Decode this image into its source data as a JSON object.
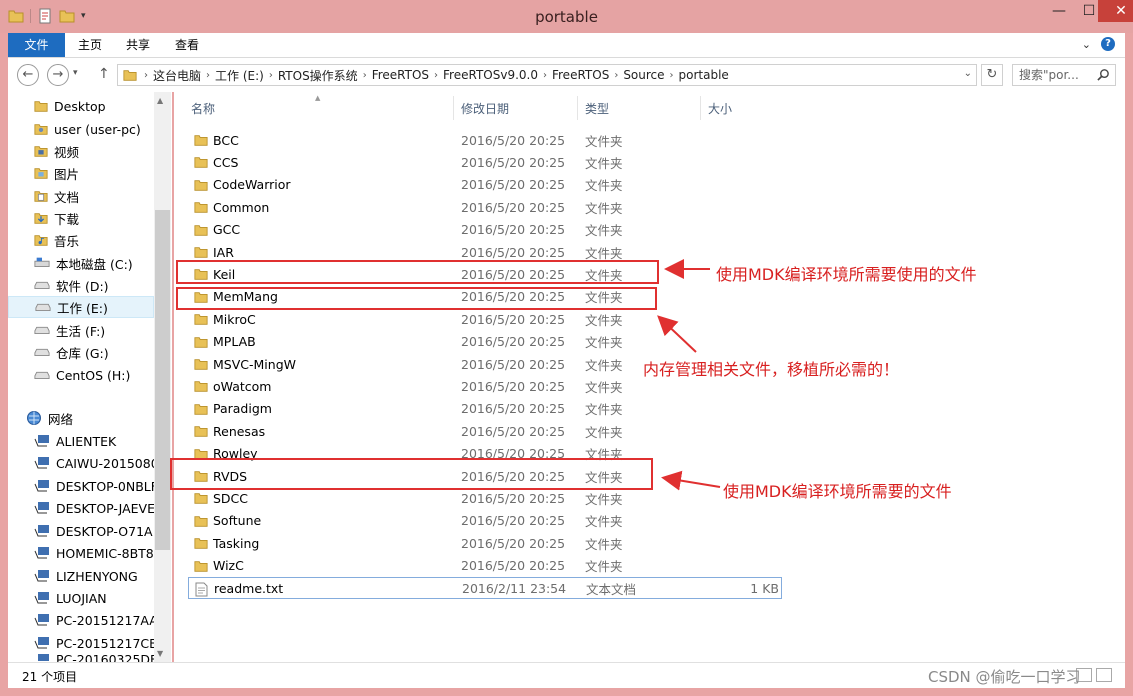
{
  "window": {
    "title": "portable",
    "minimize_glyph": "—",
    "maximize_glyph": "☐",
    "close_glyph": "✕"
  },
  "ribbon": {
    "tabs": [
      "文件",
      "主页",
      "共享",
      "查看"
    ],
    "expand_glyph": "⌄",
    "help_glyph": "?"
  },
  "address": {
    "crumbs": [
      "这台电脑",
      "工作 (E:)",
      "RTOS操作系统",
      "FreeRTOS",
      "FreeRTOSv9.0.0",
      "FreeRTOS",
      "Source",
      "portable"
    ],
    "search_placeholder": "搜索\"por..."
  },
  "nav_pane": {
    "items": [
      {
        "label": "Desktop",
        "icon": "folder-icon"
      },
      {
        "label": "user (user-pc)",
        "icon": "user-folder-icon"
      },
      {
        "label": "视频",
        "icon": "video-folder-icon"
      },
      {
        "label": "图片",
        "icon": "pictures-folder-icon"
      },
      {
        "label": "文档",
        "icon": "documents-folder-icon"
      },
      {
        "label": "下载",
        "icon": "downloads-folder-icon"
      },
      {
        "label": "音乐",
        "icon": "music-folder-icon"
      },
      {
        "label": "本地磁盘 (C:)",
        "icon": "system-drive-icon"
      },
      {
        "label": "软件 (D:)",
        "icon": "drive-icon"
      },
      {
        "label": "工作 (E:)",
        "icon": "drive-icon",
        "selected": true
      },
      {
        "label": "生活 (F:)",
        "icon": "drive-icon"
      },
      {
        "label": "仓库 (G:)",
        "icon": "drive-icon"
      },
      {
        "label": "CentOS (H:)",
        "icon": "drive-icon"
      },
      {
        "label": "网络",
        "icon": "network-icon"
      },
      {
        "label": "ALIENTEK",
        "icon": "computer-icon"
      },
      {
        "label": "CAIWU-2015080",
        "icon": "computer-icon"
      },
      {
        "label": "DESKTOP-0NBLF",
        "icon": "computer-icon"
      },
      {
        "label": "DESKTOP-JAEVE",
        "icon": "computer-icon"
      },
      {
        "label": "DESKTOP-O71A",
        "icon": "computer-icon"
      },
      {
        "label": "HOMEMIC-8BT8",
        "icon": "computer-icon"
      },
      {
        "label": "LIZHENYONG",
        "icon": "computer-icon"
      },
      {
        "label": "LUOJIAN",
        "icon": "computer-icon"
      },
      {
        "label": "PC-20151217AA",
        "icon": "computer-icon"
      },
      {
        "label": "PC-20151217CB",
        "icon": "computer-icon"
      },
      {
        "label": "PC-20160325DF",
        "icon": "computer-icon"
      }
    ]
  },
  "columns": {
    "name": "名称",
    "date": "修改日期",
    "type": "类型",
    "size": "大小"
  },
  "files": [
    {
      "name": "BCC",
      "date": "2016/5/20 20:25",
      "type": "文件夹",
      "size": ""
    },
    {
      "name": "CCS",
      "date": "2016/5/20 20:25",
      "type": "文件夹",
      "size": ""
    },
    {
      "name": "CodeWarrior",
      "date": "2016/5/20 20:25",
      "type": "文件夹",
      "size": ""
    },
    {
      "name": "Common",
      "date": "2016/5/20 20:25",
      "type": "文件夹",
      "size": ""
    },
    {
      "name": "GCC",
      "date": "2016/5/20 20:25",
      "type": "文件夹",
      "size": ""
    },
    {
      "name": "IAR",
      "date": "2016/5/20 20:25",
      "type": "文件夹",
      "size": ""
    },
    {
      "name": "Keil",
      "date": "2016/5/20 20:25",
      "type": "文件夹",
      "size": ""
    },
    {
      "name": "MemMang",
      "date": "2016/5/20 20:25",
      "type": "文件夹",
      "size": ""
    },
    {
      "name": "MikroC",
      "date": "2016/5/20 20:25",
      "type": "文件夹",
      "size": ""
    },
    {
      "name": "MPLAB",
      "date": "2016/5/20 20:25",
      "type": "文件夹",
      "size": ""
    },
    {
      "name": "MSVC-MingW",
      "date": "2016/5/20 20:25",
      "type": "文件夹",
      "size": ""
    },
    {
      "name": "oWatcom",
      "date": "2016/5/20 20:25",
      "type": "文件夹",
      "size": ""
    },
    {
      "name": "Paradigm",
      "date": "2016/5/20 20:25",
      "type": "文件夹",
      "size": ""
    },
    {
      "name": "Renesas",
      "date": "2016/5/20 20:25",
      "type": "文件夹",
      "size": ""
    },
    {
      "name": "Rowley",
      "date": "2016/5/20 20:25",
      "type": "文件夹",
      "size": ""
    },
    {
      "name": "RVDS",
      "date": "2016/5/20 20:25",
      "type": "文件夹",
      "size": ""
    },
    {
      "name": "SDCC",
      "date": "2016/5/20 20:25",
      "type": "文件夹",
      "size": ""
    },
    {
      "name": "Softune",
      "date": "2016/5/20 20:25",
      "type": "文件夹",
      "size": ""
    },
    {
      "name": "Tasking",
      "date": "2016/5/20 20:25",
      "type": "文件夹",
      "size": ""
    },
    {
      "name": "WizC",
      "date": "2016/5/20 20:25",
      "type": "文件夹",
      "size": ""
    },
    {
      "name": "readme.txt",
      "date": "2016/2/11 23:54",
      "type": "文本文档",
      "size": "1 KB"
    }
  ],
  "status": {
    "item_count": "21 个项目"
  },
  "annotations": {
    "keil": "使用MDK编译环境所需要使用的文件",
    "memmang": "内存管理相关文件，移植所必需的！",
    "rvds": "使用MDK编译环境所需要的文件"
  },
  "watermark": "CSDN @偷吃一口学习",
  "colors": {
    "annotation_red": "#e03030",
    "ribbon_file_tab": "#1e6cc0",
    "title_bar": "#e5a3a3"
  }
}
